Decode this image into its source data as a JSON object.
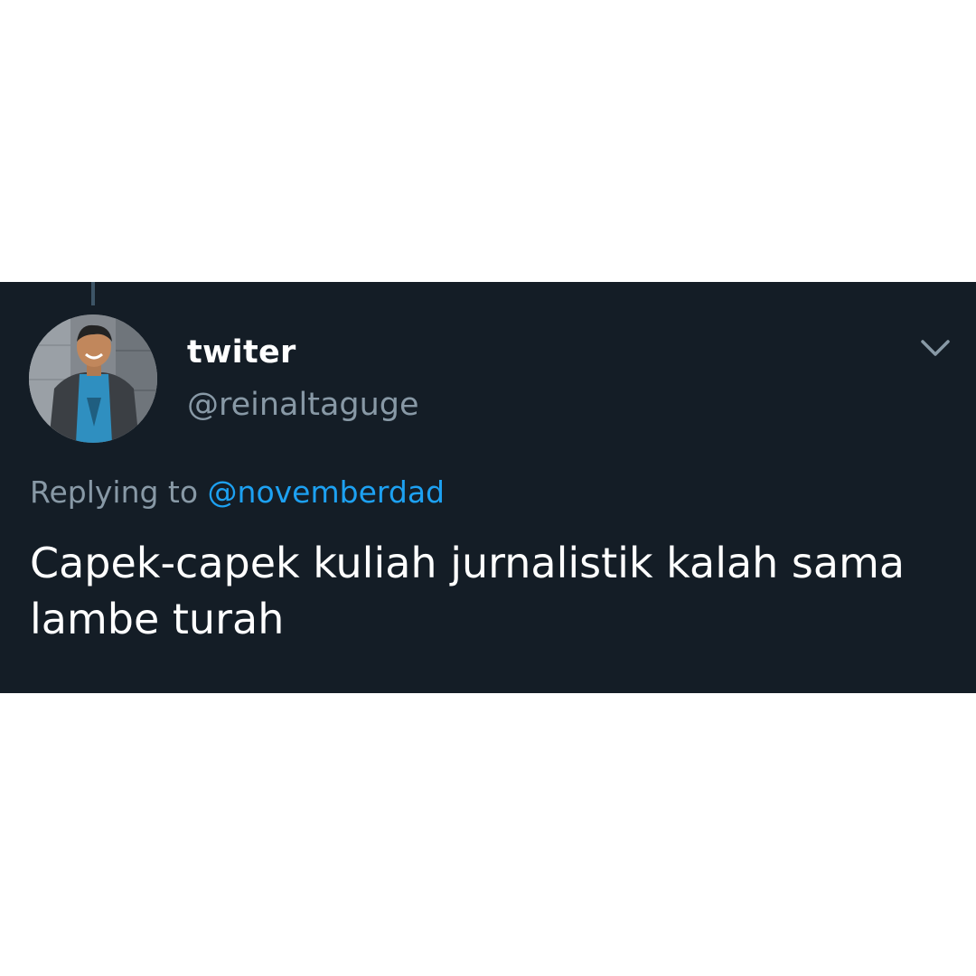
{
  "tweet": {
    "display_name": "twiter",
    "handle": "@reinaltaguge",
    "replying_prefix": "Replying to ",
    "replying_to": "@novemberdad",
    "text": "Capek-capek kuliah jurnalistik kalah sama lambe turah",
    "menu_icon": "chevron-down-icon",
    "avatar_icon": "user-avatar-photo"
  },
  "colors": {
    "card_background": "#141d26",
    "page_background": "#ffffff",
    "link_blue": "#1da1f2",
    "secondary_gray": "#8899a6",
    "primary_text": "#ffffff"
  }
}
